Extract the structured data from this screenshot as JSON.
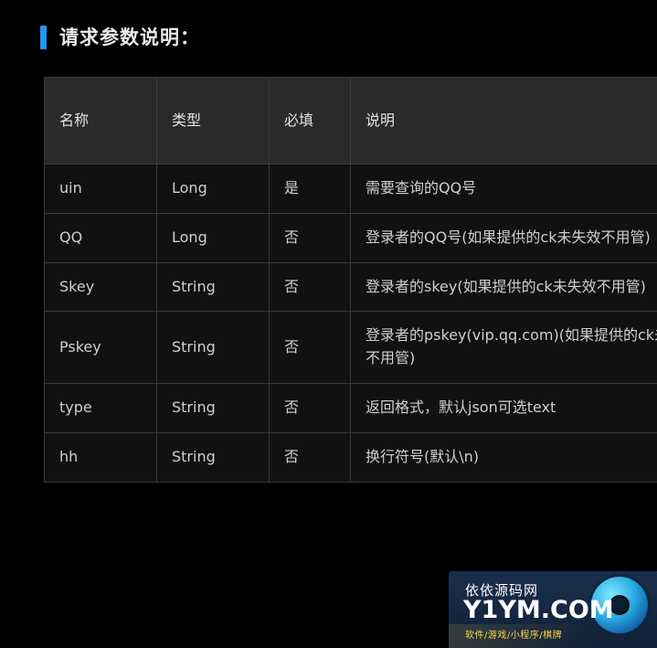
{
  "heading": {
    "title": "请求参数说明："
  },
  "table": {
    "headers": [
      "名称",
      "类型",
      "必填",
      "说明"
    ],
    "rows": [
      {
        "name": "uin",
        "type": "Long",
        "required": "是",
        "desc": "需要查询的QQ号"
      },
      {
        "name": "QQ",
        "type": "Long",
        "required": "否",
        "desc": "登录者的QQ号(如果提供的ck未失效不用管)"
      },
      {
        "name": "Skey",
        "type": "String",
        "required": "否",
        "desc": "登录者的skey(如果提供的ck未失效不用管)"
      },
      {
        "name": "Pskey",
        "type": "String",
        "required": "否",
        "desc": "登录者的pskey(vip.qq.com)(如果提供的ck未失效不用管)"
      },
      {
        "name": "type",
        "type": "String",
        "required": "否",
        "desc": "返回格式，默认json可选text"
      },
      {
        "name": "hh",
        "type": "String",
        "required": "否",
        "desc": "换行符号(默认\\n)"
      }
    ]
  },
  "watermark": {
    "line1": "依依源码网",
    "line2": "Y1YM.COM",
    "line3": "软件/游戏/小程序/棋牌"
  },
  "colors": {
    "accent": "#2196f3",
    "background": "#000000",
    "table_header_bg": "#2a2a2a",
    "table_body_bg": "#111111",
    "border": "#3a3a3a",
    "text": "#cfcfcf"
  }
}
